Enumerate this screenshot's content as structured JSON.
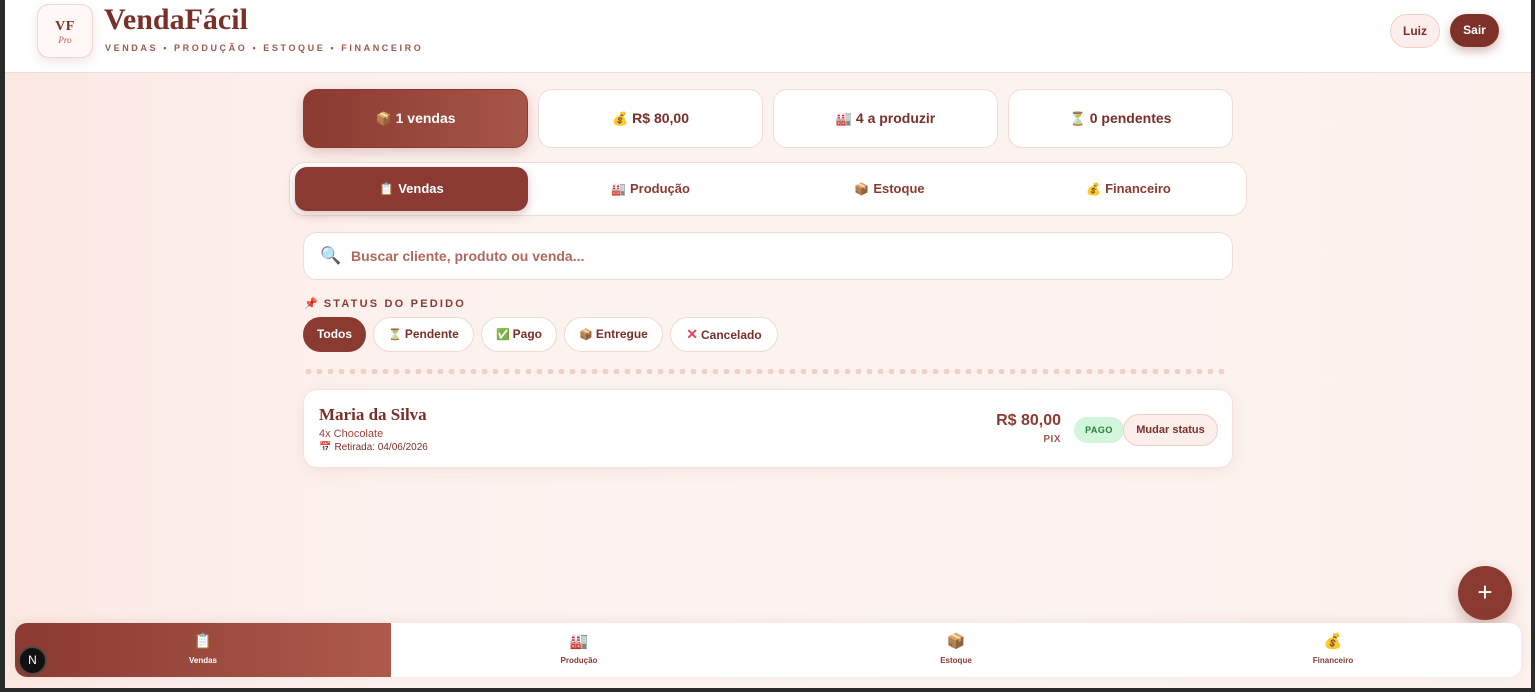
{
  "header": {
    "logo_initials": "VF",
    "logo_sub": "Pro",
    "title": "VendaFácil",
    "tagline": "VENDAS • PRODUÇÃO • ESTOQUE • FINANCEIRO",
    "user_label": "Luiz",
    "logout_label": "Sair"
  },
  "stats": [
    {
      "icon": "📦",
      "label": "1 vendas"
    },
    {
      "icon": "💰",
      "label": "R$ 80,00"
    },
    {
      "icon": "🏭",
      "label": "4 a produzir"
    },
    {
      "icon": "⏳",
      "label": "0 pendentes"
    }
  ],
  "tabs": [
    {
      "icon": "📋",
      "label": "Vendas"
    },
    {
      "icon": "🏭",
      "label": "Produção"
    },
    {
      "icon": "📦",
      "label": "Estoque"
    },
    {
      "icon": "💰",
      "label": "Financeiro"
    }
  ],
  "search": {
    "icon": "🔍",
    "placeholder": "Buscar cliente, produto ou venda...",
    "value": ""
  },
  "status_filter": {
    "icon": "📌",
    "label": "STATUS DO PEDIDO",
    "chips": [
      {
        "icon": "",
        "label": "Todos"
      },
      {
        "icon": "⏳",
        "label": "Pendente"
      },
      {
        "icon": "✅",
        "label": "Pago"
      },
      {
        "icon": "📦",
        "label": "Entregue"
      },
      {
        "icon": "✕",
        "label": "Cancelado"
      }
    ]
  },
  "orders": [
    {
      "customer": "Maria da Silva",
      "items": "4x Chocolate",
      "pickup_icon": "📅",
      "pickup": "Retirada: 04/06/2026",
      "value": "R$ 80,00",
      "method": "PIX",
      "status": "PAGO",
      "action_label": "Mudar status"
    }
  ],
  "fab_label": "+",
  "bottom_nav": [
    {
      "icon": "📋",
      "label": "Vendas"
    },
    {
      "icon": "🏭",
      "label": "Produção"
    },
    {
      "icon": "📦",
      "label": "Estoque"
    },
    {
      "icon": "💰",
      "label": "Financeiro"
    }
  ],
  "dev_badge": "N",
  "colors": {
    "primary": "#8b3a31",
    "primary_dark": "#7a2f28",
    "background": "#fcf1ee",
    "paid_bg": "#d3f5dc",
    "paid_text": "#23813d"
  }
}
